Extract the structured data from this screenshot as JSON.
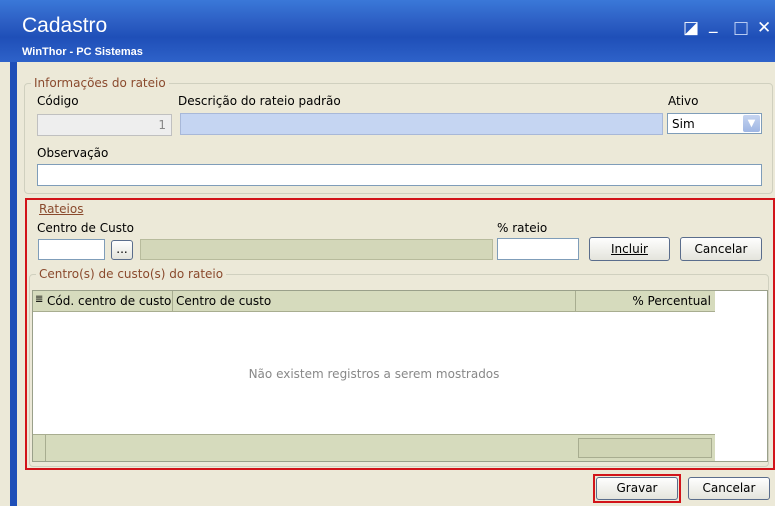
{
  "window": {
    "title": "Cadastro",
    "subtitle": "WinThor - PC Sistemas",
    "restore_glyph": "◪",
    "minimize_glyph": "_",
    "maximize_glyph": "□",
    "close_glyph": "✕"
  },
  "info": {
    "legend": "Informações do rateio",
    "codigo_label": "Código",
    "codigo_value": "1",
    "descricao_label": "Descrição do rateio padrão",
    "descricao_value": "",
    "ativo_label": "Ativo",
    "ativo_value": "Sim",
    "observacao_label": "Observação",
    "observacao_value": ""
  },
  "rateios": {
    "legend": "Rateios",
    "centro_label": "Centro de Custo",
    "browse_label": "...",
    "rateio_label": "% rateio",
    "incluir_label": "Incluir",
    "cancelar_label": "Cancelar"
  },
  "grid": {
    "legend": "Centro(s) de custo(s) do rateio",
    "col1": "Cód. centro de custo",
    "col2": "Centro de custo",
    "col3": "% Percentual",
    "empty_text": "Não existem registros a serem mostrados"
  },
  "footer": {
    "gravar_label": "Gravar",
    "cancelar_label": "Cancelar"
  },
  "colors": {
    "titlebar": "#2d5fc4",
    "highlight": "#d2141a",
    "legend": "#8a4a2d"
  }
}
